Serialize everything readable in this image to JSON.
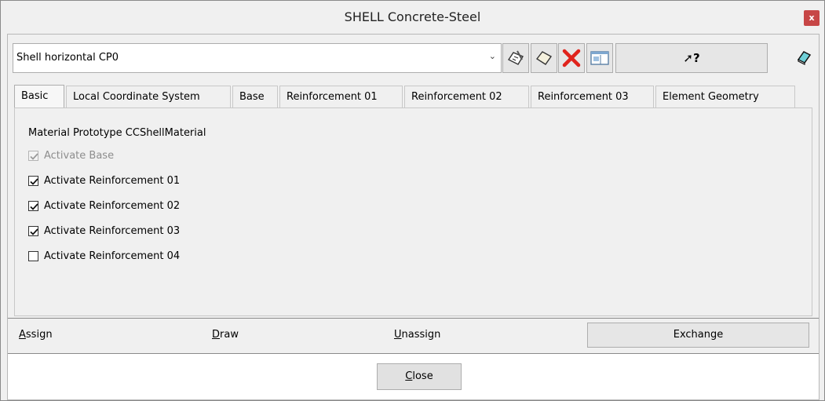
{
  "window": {
    "title": "SHELL Concrete-Steel",
    "close_label": "x"
  },
  "toolbar": {
    "selected_item": "Shell horizontal CP0",
    "buttons": [
      "edit-icon",
      "new-icon",
      "delete-icon",
      "window-icon",
      "help-pointer-icon",
      "eraser-icon"
    ],
    "help_glyph": "?"
  },
  "tabs": [
    {
      "label": "Basic",
      "active": true
    },
    {
      "label": "Local Coordinate System",
      "active": false
    },
    {
      "label": "Base",
      "active": false
    },
    {
      "label": "Reinforcement 01",
      "active": false
    },
    {
      "label": "Reinforcement 02",
      "active": false
    },
    {
      "label": "Reinforcement 03",
      "active": false
    },
    {
      "label": "Element Geometry",
      "active": false
    }
  ],
  "panel": {
    "prototype_label": "Material Prototype CCShellMaterial",
    "checks": [
      {
        "label": "Activate Base",
        "checked": true,
        "disabled": true
      },
      {
        "label": "Activate Reinforcement 01",
        "checked": true,
        "disabled": false
      },
      {
        "label": "Activate Reinforcement 02",
        "checked": true,
        "disabled": false
      },
      {
        "label": "Activate Reinforcement 03",
        "checked": true,
        "disabled": false
      },
      {
        "label": "Activate Reinforcement 04",
        "checked": false,
        "disabled": false
      }
    ]
  },
  "actions": {
    "assign_u": "A",
    "assign_rest": "ssign",
    "draw_u": "D",
    "draw_rest": "raw",
    "unassign_u": "U",
    "unassign_rest": "nassign",
    "exchange": "Exchange"
  },
  "footer": {
    "close_u": "C",
    "close_rest": "lose"
  }
}
